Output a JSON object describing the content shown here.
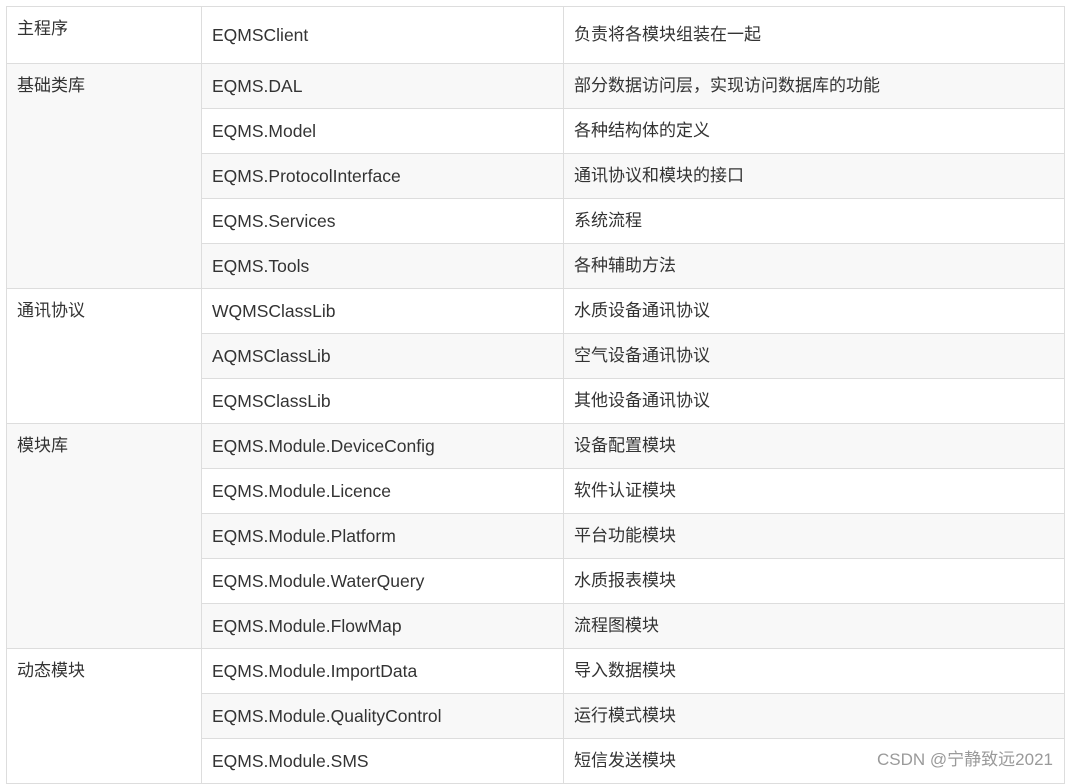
{
  "groups": [
    {
      "name": "主程序",
      "rows": [
        {
          "project": "EQMSClient",
          "description": "负责将各模块组装在一起"
        }
      ]
    },
    {
      "name": "基础类库",
      "rows": [
        {
          "project": "EQMS.DAL",
          "description": "部分数据访问层，实现访问数据库的功能"
        },
        {
          "project": "EQMS.Model",
          "description": "各种结构体的定义"
        },
        {
          "project": "EQMS.ProtocolInterface",
          "description": "通讯协议和模块的接口"
        },
        {
          "project": "EQMS.Services",
          "description": "系统流程"
        },
        {
          "project": "EQMS.Tools",
          "description": "各种辅助方法"
        }
      ]
    },
    {
      "name": "通讯协议",
      "rows": [
        {
          "project": "WQMSClassLib",
          "description": "水质设备通讯协议"
        },
        {
          "project": "AQMSClassLib",
          "description": "空气设备通讯协议"
        },
        {
          "project": "EQMSClassLib",
          "description": "其他设备通讯协议"
        }
      ]
    },
    {
      "name": "模块库",
      "rows": [
        {
          "project": "EQMS.Module.DeviceConfig",
          "description": "设备配置模块"
        },
        {
          "project": "EQMS.Module.Licence",
          "description": "软件认证模块"
        },
        {
          "project": "EQMS.Module.Platform",
          "description": "平台功能模块"
        },
        {
          "project": "EQMS.Module.WaterQuery",
          "description": "水质报表模块"
        },
        {
          "project": "EQMS.Module.FlowMap",
          "description": "流程图模块"
        }
      ]
    },
    {
      "name": "动态模块",
      "rows": [
        {
          "project": "EQMS.Module.ImportData",
          "description": "导入数据模块"
        },
        {
          "project": "EQMS.Module.QualityControl",
          "description": "运行模式模块"
        },
        {
          "project": "EQMS.Module.SMS",
          "description": "短信发送模块"
        }
      ]
    }
  ],
  "watermark": "CSDN @宁静致远2021",
  "colors": {
    "border": "#dddddd",
    "shaded_row": "#f8f8f8",
    "text": "#333333",
    "watermark": "#9a9a9a"
  }
}
